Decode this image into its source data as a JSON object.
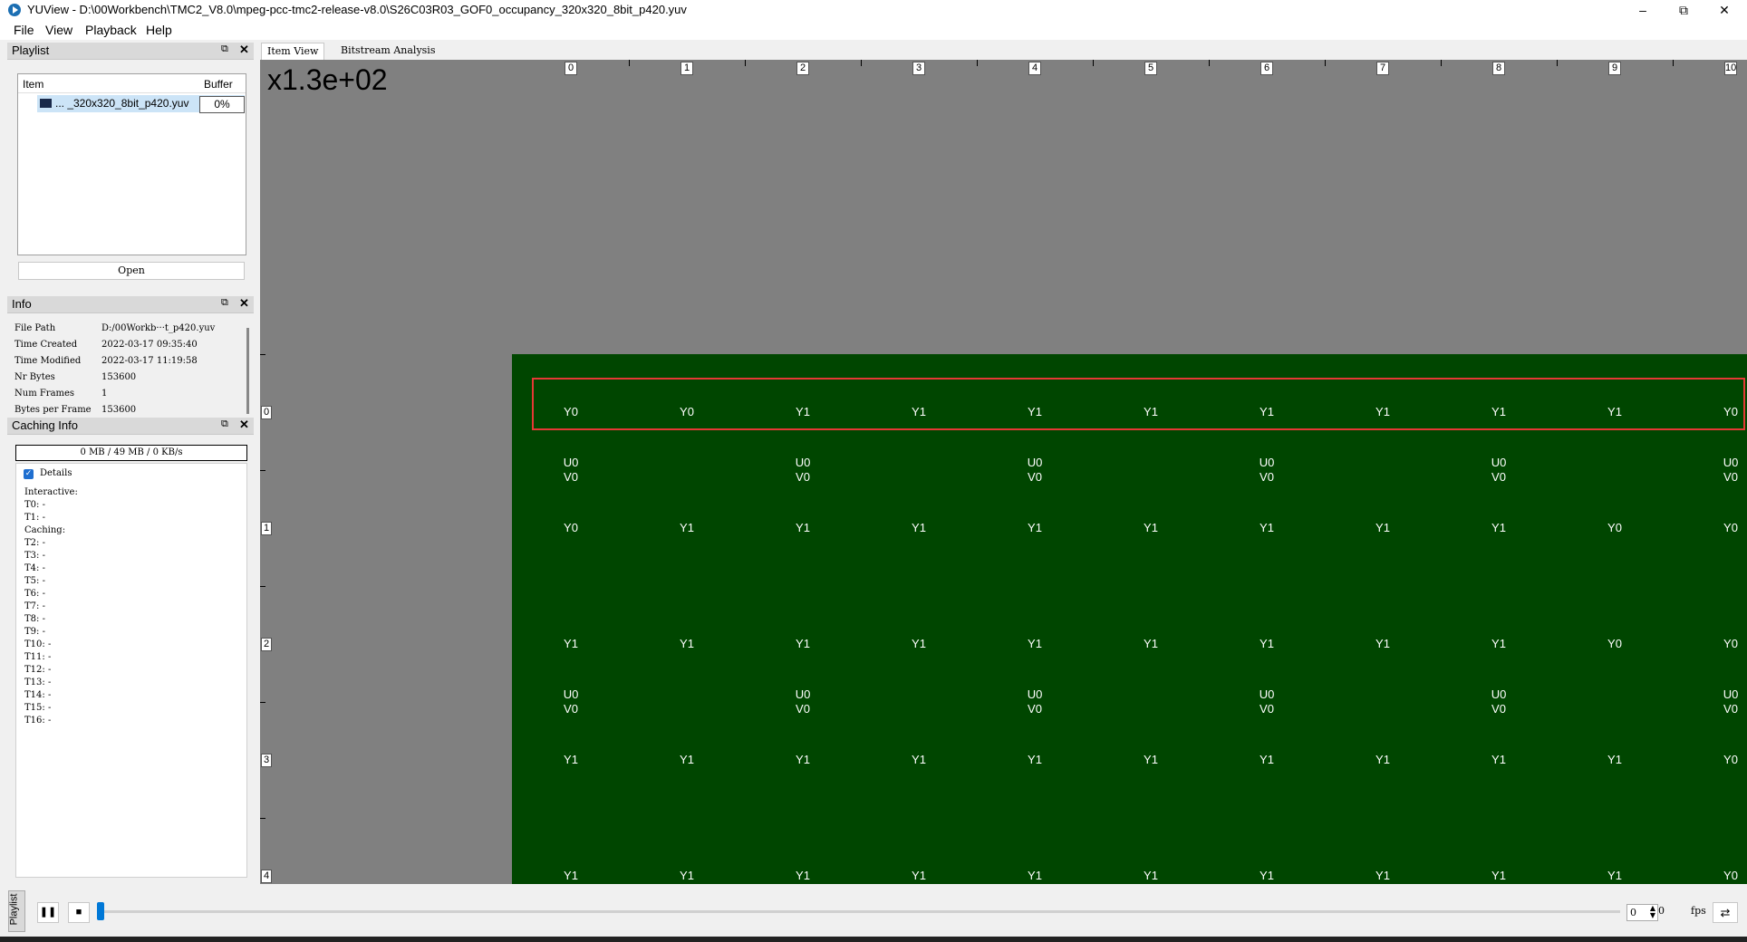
{
  "window": {
    "title": "YUView - D:\\00Workbench\\TMC2_V8.0\\mpeg-pcc-tmc2-release-v8.0\\S26C03R03_GOF0_occupancy_320x320_8bit_p420.yuv",
    "minimize": "–",
    "maximize": "⧉",
    "close": "✕"
  },
  "menu": [
    {
      "label": "File"
    },
    {
      "label": "View"
    },
    {
      "label": "Playback"
    },
    {
      "label": "Help"
    }
  ],
  "playlist_panel": {
    "title": "Playlist",
    "col_item": "Item",
    "col_buffer": "Buffer",
    "item_name": "... _320x320_8bit_p420.yuv",
    "item_buffer": "0%",
    "open_label": "Open"
  },
  "info_panel": {
    "title": "Info",
    "rows": [
      {
        "key": "File Path",
        "value": "D:/00Workb···t_p420.yuv"
      },
      {
        "key": "Time Created",
        "value": "2022-03-17 09:35:40"
      },
      {
        "key": "Time Modified",
        "value": "2022-03-17 11:19:58"
      },
      {
        "key": "Nr Bytes",
        "value": "153600"
      },
      {
        "key": "Num Frames",
        "value": "1"
      },
      {
        "key": "Bytes per Frame",
        "value": "153600"
      }
    ]
  },
  "caching_panel": {
    "title": "Caching Info",
    "summary": "0 MB / 49 MB / 0 KB/s",
    "details_label": "Details",
    "details_checked": true,
    "lines": [
      "Interactive:",
      "T0: -",
      "T1: -",
      "Caching:",
      "T2: -",
      "T3: -",
      "T4: -",
      "T5: -",
      "T6: -",
      "T7: -",
      "T8: -",
      "T9: -",
      "T10: -",
      "T11: -",
      "T12: -",
      "T13: -",
      "T14: -",
      "T15: -",
      "T16: -"
    ]
  },
  "tabs": [
    {
      "label": "Item View",
      "active": true
    },
    {
      "label": "Bitstream Analysis",
      "active": false
    }
  ],
  "view": {
    "zoom_label": "x1.3e+02",
    "x_labels": [
      "0",
      "1",
      "2",
      "3",
      "4",
      "5",
      "6",
      "7",
      "8",
      "9",
      "10"
    ],
    "y_labels": [
      "0",
      "1",
      "2",
      "3",
      "4"
    ],
    "colors": {
      "background": "#808080",
      "image": "#004600",
      "highlight": "#e53935"
    },
    "luma_rows": [
      [
        "Y0",
        "Y0",
        "Y1",
        "Y1",
        "Y1",
        "Y1",
        "Y1",
        "Y1",
        "Y1",
        "Y1",
        "Y0"
      ],
      [
        "Y0",
        "Y1",
        "Y1",
        "Y1",
        "Y1",
        "Y1",
        "Y1",
        "Y1",
        "Y1",
        "Y0",
        "Y0"
      ],
      [
        "Y1",
        "Y1",
        "Y1",
        "Y1",
        "Y1",
        "Y1",
        "Y1",
        "Y1",
        "Y1",
        "Y0",
        "Y0"
      ],
      [
        "Y1",
        "Y1",
        "Y1",
        "Y1",
        "Y1",
        "Y1",
        "Y1",
        "Y1",
        "Y1",
        "Y1",
        "Y0"
      ],
      [
        "Y1",
        "Y1",
        "Y1",
        "Y1",
        "Y1",
        "Y1",
        "Y1",
        "Y1",
        "Y1",
        "Y1",
        "Y0"
      ]
    ],
    "chroma_u": "U0",
    "chroma_v": "V0"
  },
  "playback": {
    "vtab_label": "Playlist",
    "pause_icon": "❚❚",
    "stop_icon": "■",
    "frame_value": "0",
    "frame_total": "0",
    "fps_label": "fps",
    "repeat_icon": "⇄",
    "position_fraction": 0
  }
}
